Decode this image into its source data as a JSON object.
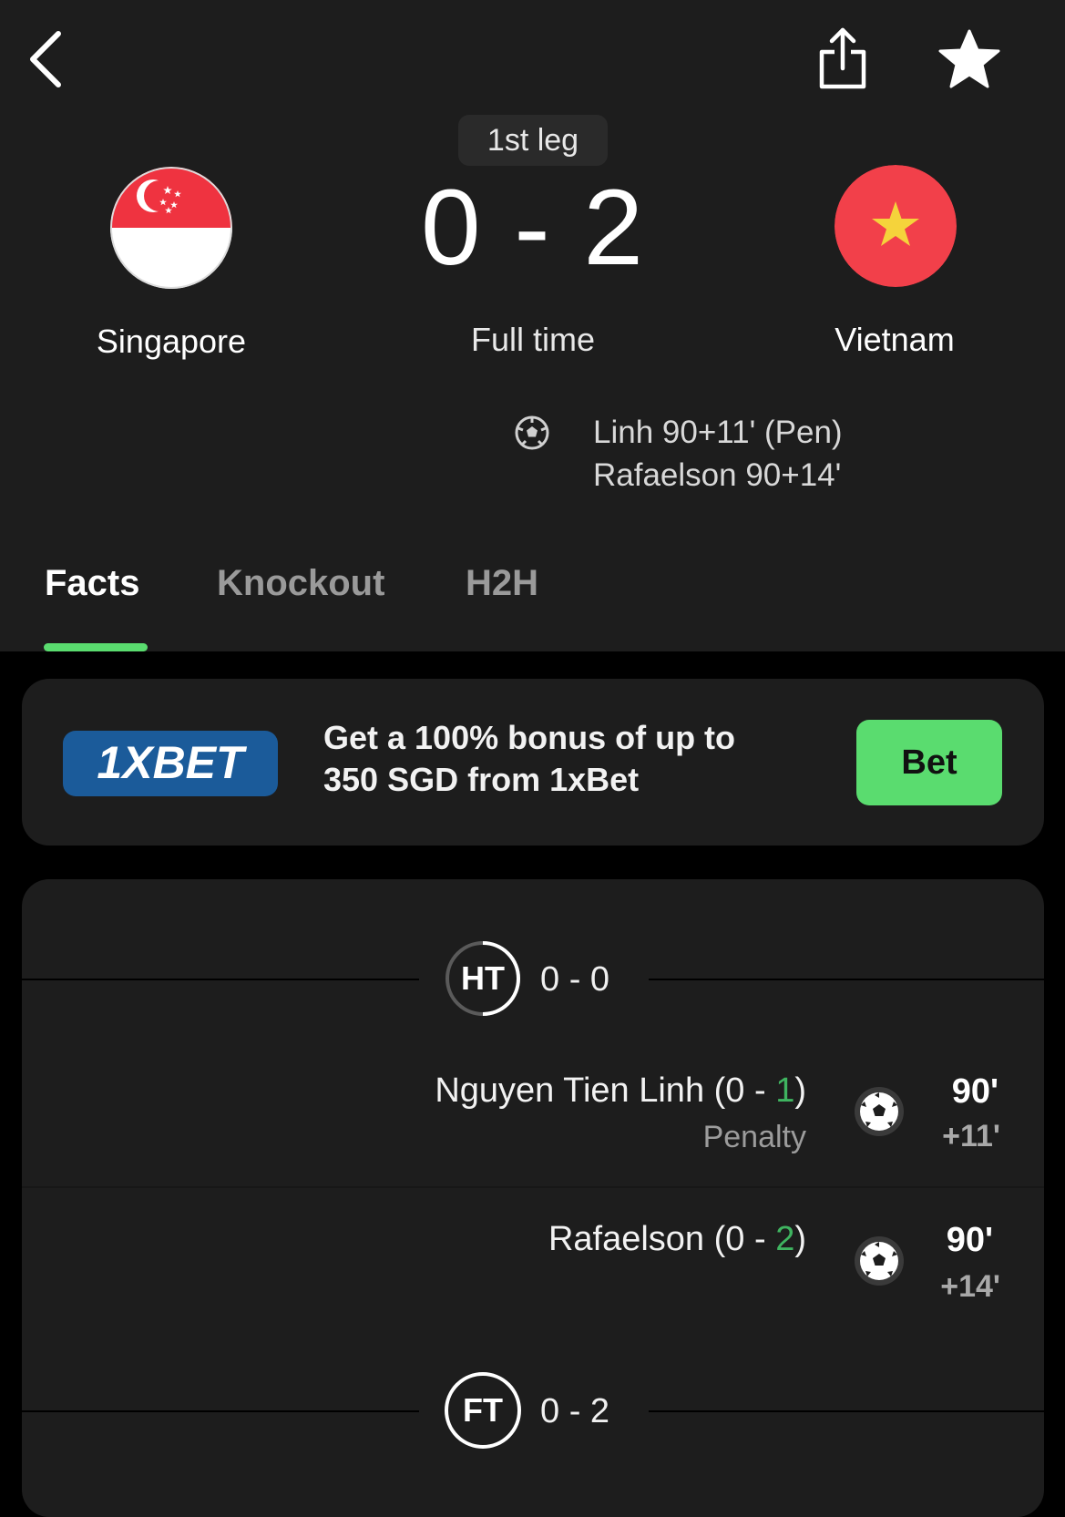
{
  "match": {
    "leg": "1st leg",
    "score": "0 - 2",
    "status": "Full time",
    "home": {
      "name": "Singapore"
    },
    "away": {
      "name": "Vietnam"
    },
    "scorers": [
      "Linh 90+11' (Pen)",
      "Rafaelson 90+14'"
    ]
  },
  "tabs": [
    {
      "label": "Facts",
      "active": true
    },
    {
      "label": "Knockout",
      "active": false
    },
    {
      "label": "H2H",
      "active": false
    }
  ],
  "ad": {
    "logo_text": "1XBET",
    "text_line1": "Get a 100% bonus of up to",
    "text_line2": "350 SGD from 1xBet",
    "button": "Bet"
  },
  "events": {
    "ht": {
      "label": "HT",
      "score": "0 - 0"
    },
    "goals": [
      {
        "name": "Nguyen Tien Linh",
        "prefix": "(0 - ",
        "highlight": "1",
        "suffix": ")",
        "detail": "Penalty",
        "minute": "90'",
        "added": "+11'"
      },
      {
        "name": "Rafaelson",
        "prefix": "(0 - ",
        "highlight": "2",
        "suffix": ")",
        "detail": "",
        "minute": "90'",
        "added": "+14'"
      }
    ],
    "ft": {
      "label": "FT",
      "score": "0 - 2"
    }
  },
  "colors": {
    "accent": "#5adc6f",
    "goal_highlight": "#3fb460",
    "singapore_red": "#ef3340",
    "vietnam_red": "#f2404a",
    "vietnam_star": "#f5d33b",
    "xbet_blue": "#1b5b9a"
  },
  "icons": [
    "back-chevron-icon",
    "share-icon",
    "star-icon",
    "soccer-ball-icon"
  ]
}
